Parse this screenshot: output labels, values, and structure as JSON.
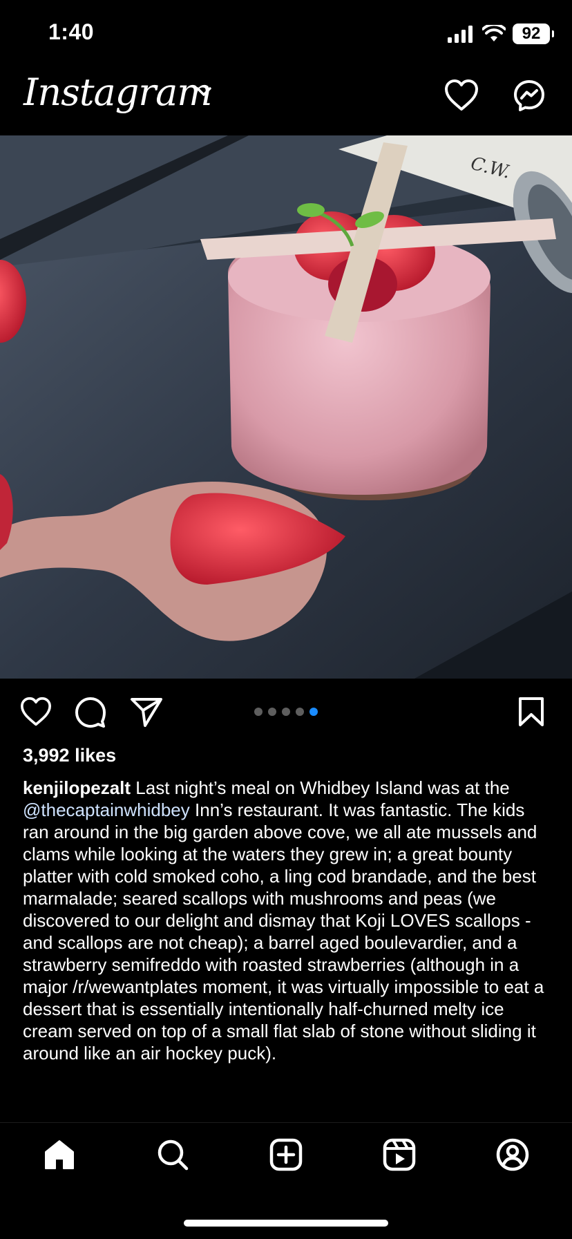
{
  "status": {
    "time": "1:40",
    "battery": "92"
  },
  "header": {
    "logo": "Instagram"
  },
  "post": {
    "carousel_total": 5,
    "carousel_active": 5,
    "likes": "3,992 likes",
    "caption_user": "kenjilopezalt",
    "caption_pre": " Last night’s meal on Whidbey Island was at the ",
    "caption_mention": "@thecaptainwhidbey",
    "caption_post": " Inn’s restaurant. It was fantastic. The kids ran around in the big garden above cove, we all ate mussels and clams while looking at the waters they grew in; a great bounty platter with cold smoked coho, a ling cod brandade, and the best marmalade; seared scallops with mushrooms and peas (we discovered to our delight and dismay that Koji LOVES scallops - and scallops are not cheap); a barrel aged boulevardier, and a strawberry semifreddo with roasted strawberries (although in a major /r/wewantplates moment, it was virtually impossible to eat a dessert that is essentially intentionally half-churned melty ice cream served on top of a small flat slab of stone without sliding it around like an air hockey puck).",
    "card_text": "C.W."
  },
  "icons": {
    "header": [
      "chevron-down-icon",
      "heart-icon",
      "messenger-icon"
    ],
    "actions": [
      "heart-icon",
      "comment-icon",
      "share-icon",
      "bookmark-icon"
    ],
    "tabbar": [
      "home-icon",
      "search-icon",
      "create-icon",
      "reels-icon",
      "profile-icon"
    ]
  },
  "colors": {
    "background": "#000000",
    "accent": "#1a8cff",
    "text": "#ffffff"
  }
}
